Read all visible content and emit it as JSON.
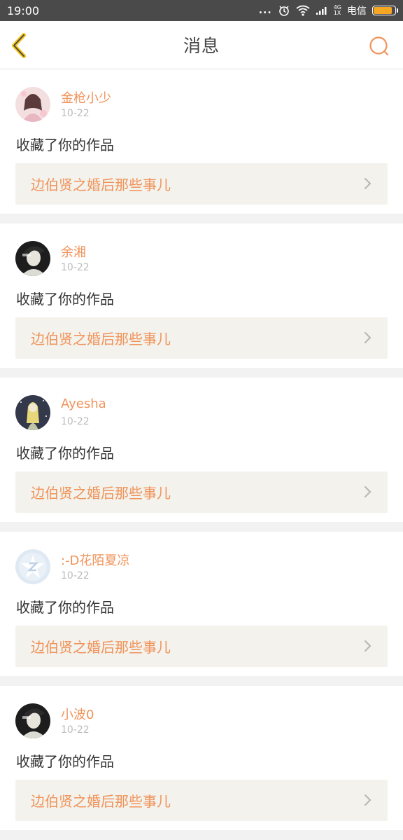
{
  "status_bar": {
    "time": "19:00",
    "dots": "...",
    "net_top": "4G",
    "net_bottom": "1X",
    "carrier": "电信",
    "battery_level": 0.85
  },
  "header": {
    "title": "消息",
    "back_icon": "chevron-left-icon",
    "search_icon": "search-icon"
  },
  "colors": {
    "accent": "#f0935a",
    "back_icon": "#f5c518",
    "link_bg": "#f3f2ec"
  },
  "messages": [
    {
      "username": "金枪小少",
      "date": "10-22",
      "action": "收藏了你的作品",
      "work_title": "边伯贤之婚后那些事儿",
      "avatar": "avatar-girl-pink"
    },
    {
      "username": "余湘",
      "date": "10-22",
      "action": "收藏了你的作品",
      "work_title": "边伯贤之婚后那些事儿",
      "avatar": "avatar-dark-portrait"
    },
    {
      "username": "Ayesha",
      "date": "10-22",
      "action": "收藏了你的作品",
      "work_title": "边伯贤之婚后那些事儿",
      "avatar": "avatar-illustration"
    },
    {
      "username": ":-D花陌夏凉",
      "date": "10-22",
      "action": "收藏了你的作品",
      "work_title": "边伯贤之婚后那些事儿",
      "avatar": "avatar-qq-default"
    },
    {
      "username": "小波0",
      "date": "10-22",
      "action": "收藏了你的作品",
      "work_title": "边伯贤之婚后那些事儿",
      "avatar": "avatar-dark-portrait"
    }
  ]
}
